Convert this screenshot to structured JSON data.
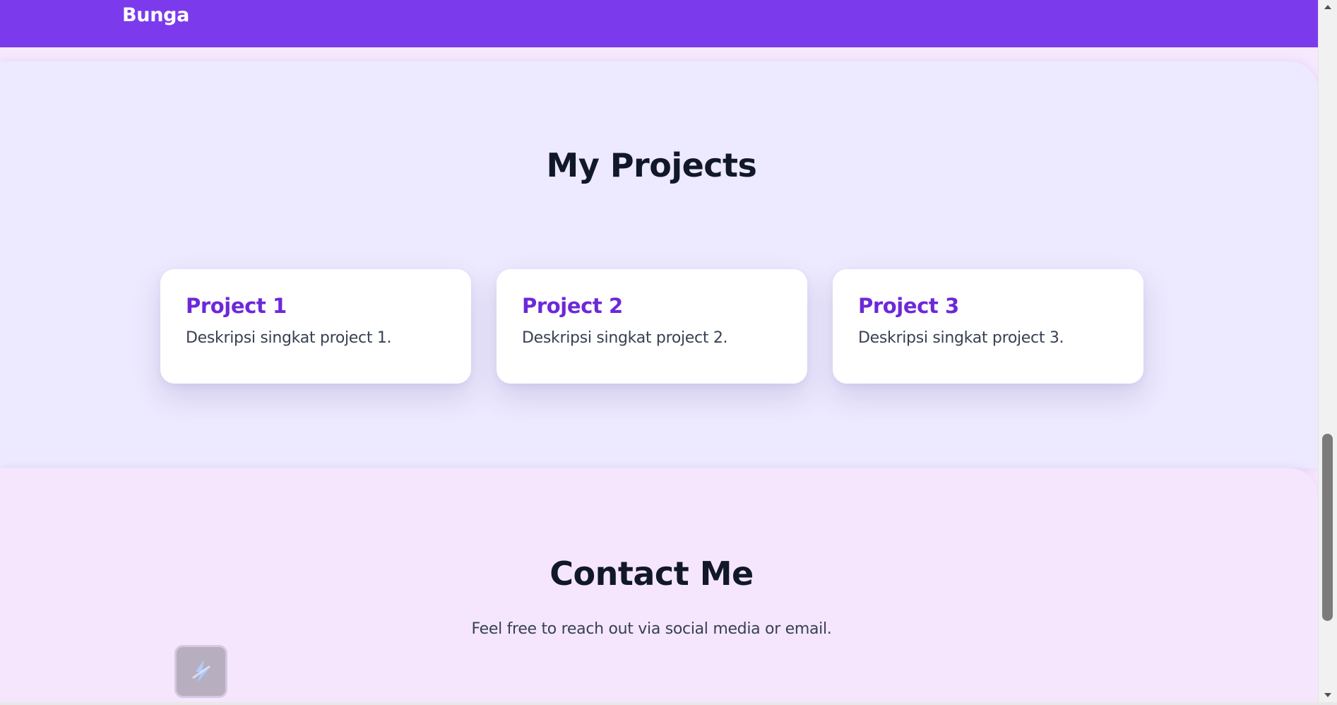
{
  "header": {
    "brand": "Bunga"
  },
  "projects_section": {
    "title": "My Projects",
    "cards": [
      {
        "title": "Project 1",
        "description": "Deskripsi singkat project 1."
      },
      {
        "title": "Project 2",
        "description": "Deskripsi singkat project 2."
      },
      {
        "title": "Project 3",
        "description": "Deskripsi singkat project 3."
      }
    ]
  },
  "contact_section": {
    "title": "Contact Me",
    "text": "Feel free to reach out via social media or email."
  },
  "floating_widget": {
    "icon": "lightning-icon"
  },
  "scrollbar": {
    "up_icon": "scroll-up-arrow-icon",
    "down_icon": "scroll-down-arrow-icon"
  },
  "colors": {
    "header_bg": "#7c3aed",
    "projects_bg": "#ede9fe",
    "contact_bg": "#f5e6fe",
    "card_title": "#6d28d9",
    "heading": "#111827",
    "body_text": "#374151"
  }
}
